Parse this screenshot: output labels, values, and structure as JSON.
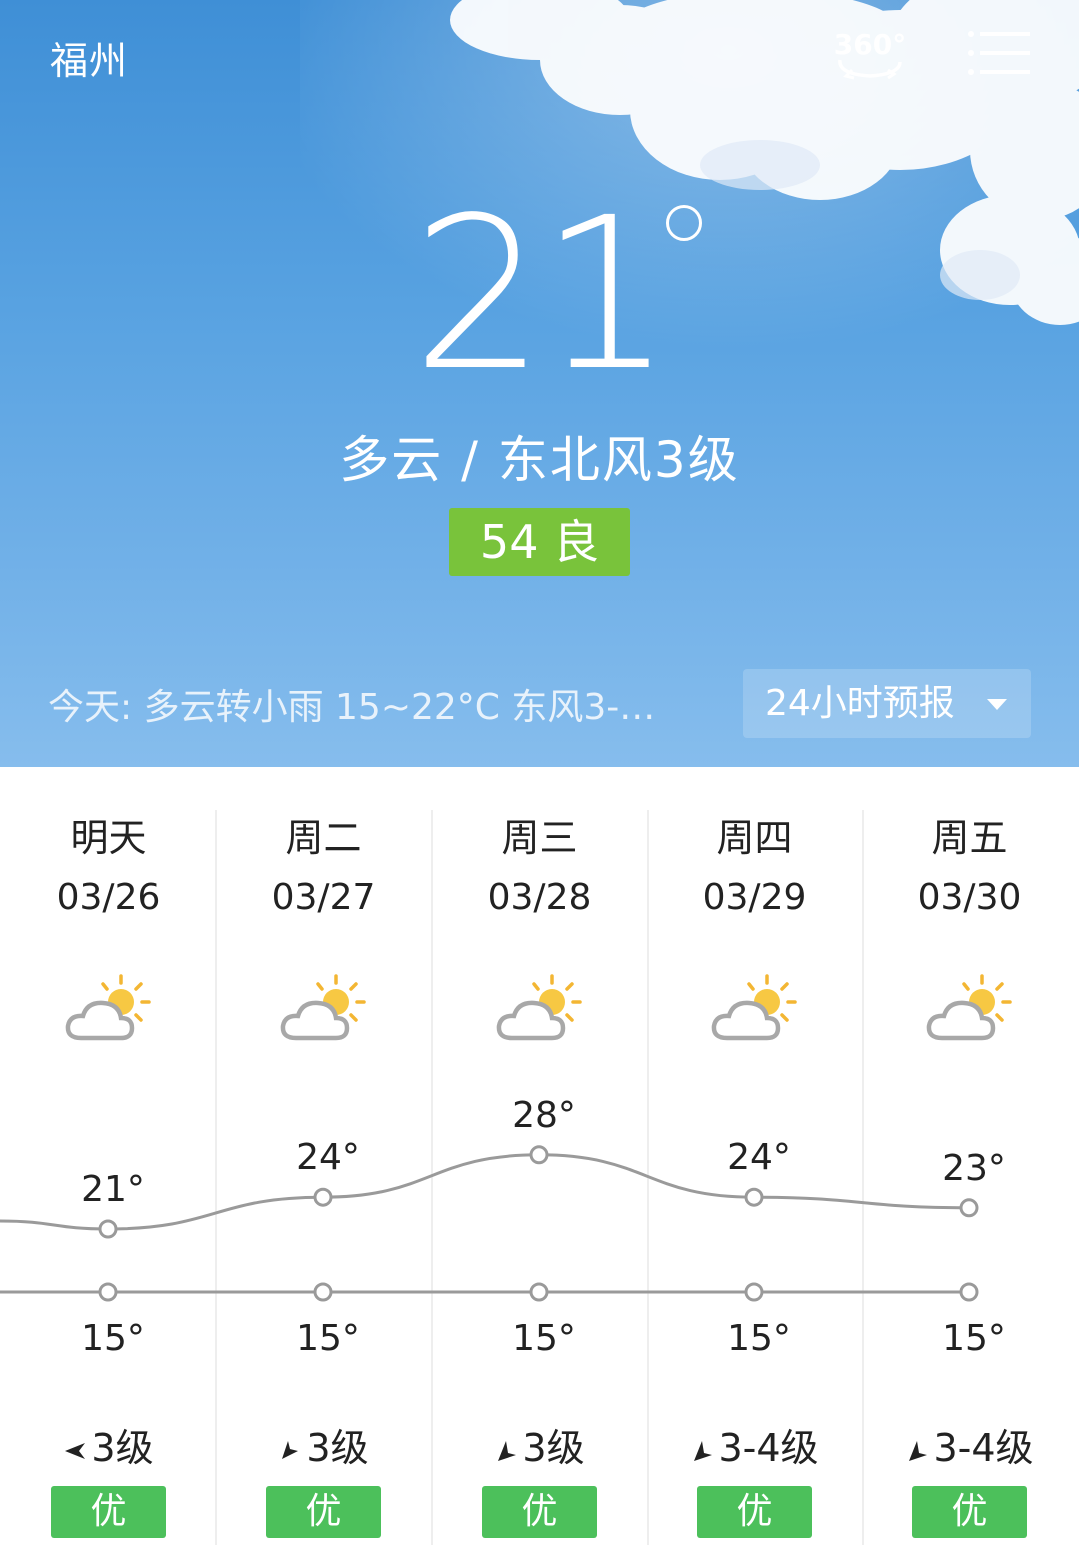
{
  "header": {
    "city": "福州",
    "panorama_label": "360°",
    "panorama_icon": "360-view-icon",
    "menu_icon": "list-menu-icon"
  },
  "current": {
    "temperature": "21",
    "condition_line": "多云  /  东北风3级",
    "aqi_badge": "54 良",
    "aqi_color": "#79c33b"
  },
  "today": {
    "summary": "今天:  多云转小雨   15~22°C   东风3-…",
    "forecast_button": "24小时预报"
  },
  "days": [
    {
      "name": "明天",
      "date": "03/26",
      "icon": "partly-cloudy-icon",
      "wind": "3级",
      "wind_dir": "left",
      "aq": "优"
    },
    {
      "name": "周二",
      "date": "03/27",
      "icon": "partly-cloudy-icon",
      "wind": "3级",
      "wind_dir": "down-left",
      "aq": "优"
    },
    {
      "name": "周三",
      "date": "03/28",
      "icon": "partly-cloudy-icon",
      "wind": "3级",
      "wind_dir": "up-right",
      "aq": "优"
    },
    {
      "name": "周四",
      "date": "03/29",
      "icon": "partly-cloudy-icon",
      "wind": "3-4级",
      "wind_dir": "up-right",
      "aq": "优"
    },
    {
      "name": "周五",
      "date": "03/30",
      "icon": "partly-cloudy-icon",
      "wind": "3-4级",
      "wind_dir": "up-right",
      "aq": "优"
    }
  ],
  "chart_data": {
    "type": "line",
    "categories": [
      "03/26",
      "03/27",
      "03/28",
      "03/29",
      "03/30"
    ],
    "series": [
      {
        "values": [
          21,
          24,
          28,
          24,
          23
        ],
        "labels": [
          "21°",
          "24°",
          "28°",
          "24°",
          "23°"
        ]
      },
      {
        "values": [
          15,
          15,
          15,
          15,
          15
        ],
        "labels": [
          "15°",
          "15°",
          "15°",
          "15°",
          "15°"
        ]
      }
    ],
    "line_color": "#9a9a9a"
  }
}
